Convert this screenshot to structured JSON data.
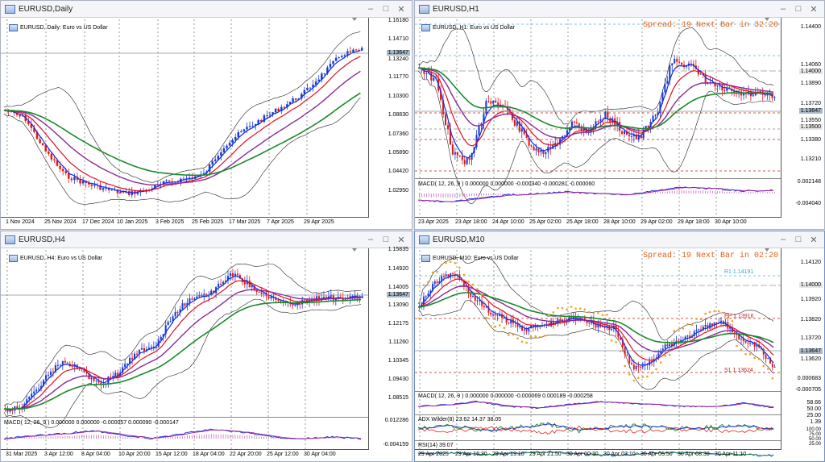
{
  "windows": {
    "daily": {
      "title": "EURUSD,Daily",
      "info": "EURUSD, Daily:  Euro vs US Dollar",
      "price_labels": [
        "1.16180",
        "1.14710",
        "1.13240",
        "1.11770",
        "1.10300",
        "1.08830",
        "1.07360",
        "1.05890",
        "1.04420",
        "1.02950"
      ],
      "current_price": "1.13647",
      "time_labels": [
        "1 Nov 2024",
        "25 Nov 2024",
        "17 Dec 2024",
        "10 Jan 2025",
        "3 Feb 2025",
        "25 Feb 2025",
        "17 Mar 2025",
        "7 Apr 2025",
        "29 Apr 2025"
      ]
    },
    "h1": {
      "title": "EURUSD,H1",
      "info": "EURUSD, H1:  Euro vs US Dollar",
      "spread_text": "Spread: 19  Next Bar in 32:20",
      "price_labels": [
        "1.14400",
        "1.14060",
        "1.13890",
        "1.13720",
        "1.13550",
        "1.13380",
        "1.13210"
      ],
      "current_price": "1.13647",
      "tag_1": "1.14000",
      "tag_2": "1.13500",
      "macd_label": "MACD( 12, 26, 9 )  0.000000  0.000000  -0.000340  -0.000281  -0.000060",
      "macd_labels": [
        "0.002148",
        "-0.004040"
      ],
      "time_labels": [
        "23 Apr 2025",
        "23 Apr 18:00",
        "24 Apr 10:00",
        "25 Apr 02:00",
        "25 Apr 18:00",
        "28 Apr 10:00",
        "29 Apr 02:00",
        "29 Apr 18:00",
        "30 Apr 10:00"
      ]
    },
    "h4": {
      "title": "EURUSD,H4",
      "info": "EURUSD, H4:  Euro vs US Dollar",
      "price_labels": [
        "1.15835",
        "1.14920",
        "1.14005",
        "1.13090",
        "1.12175",
        "1.11260",
        "1.10345",
        "1.09430",
        "1.08515"
      ],
      "current_price": "1.13647",
      "macd_label": "MACD( 12, 26, 9 )  0.000000  0.000000  -0.000057  0.000090  -0.000147",
      "macd_labels": [
        "0.012286",
        "-0.004159"
      ],
      "time_labels": [
        "31 Mar 2025",
        "3 Apr 12:00",
        "8 Apr 04:00",
        "10 Apr 20:00",
        "15 Apr 12:00",
        "18 Apr 04:00",
        "22 Apr 20:00",
        "25 Apr 12:00",
        "30 Apr 04:00"
      ]
    },
    "m10": {
      "title": "EURUSD,M10",
      "info": "EURUSD, M10:  Euro vs US Dollar",
      "spread_text": "Spread: 19  Next Bar in 02:20",
      "price_labels": [
        "1.14120",
        "1.13920",
        "1.13820",
        "1.13720",
        "1.13620"
      ],
      "current_price": "1.13647",
      "tag_1": "1.14000",
      "r1_label": "R1 1.14191",
      "pp_label": "PP 1.13916",
      "s1_label": "S1 1.13624",
      "macd_label": "MACD( 12, 26, 9 )  0.000000  0.000000  -0.000069  0.000189  -0.000258",
      "macd_labels": [
        "0.000683",
        "-0.000705"
      ],
      "adx_label": "ADX Wilder(8) 23.62  14.37  38.05",
      "adx_labels": [
        "58.66",
        "50.00",
        "25.00",
        "1.39"
      ],
      "rsi_label": "RSI(14) 39.07",
      "rsi_labels": [
        "100.00",
        "75.00",
        "50.00",
        "25.00",
        "0.00"
      ],
      "time_labels": [
        "29 Apr 2025",
        "29 Apr 16:30",
        "29 Apr 19:10",
        "29 Apr 21:50",
        "30 Apr 00:30",
        "30 Apr 03:10",
        "30 Apr 05:50",
        "30 Apr 08:30",
        "30 Apr 11:10"
      ]
    }
  },
  "colors": {
    "bull": "#1f3ccf",
    "bear": "#e0171b",
    "ma_fast": "#1030e0",
    "ma_mid": "#e01020",
    "ma_slow": "#8a2a9a",
    "ma_long": "#1a8a2a",
    "spread": "#e06018",
    "level": "#e02020"
  }
}
